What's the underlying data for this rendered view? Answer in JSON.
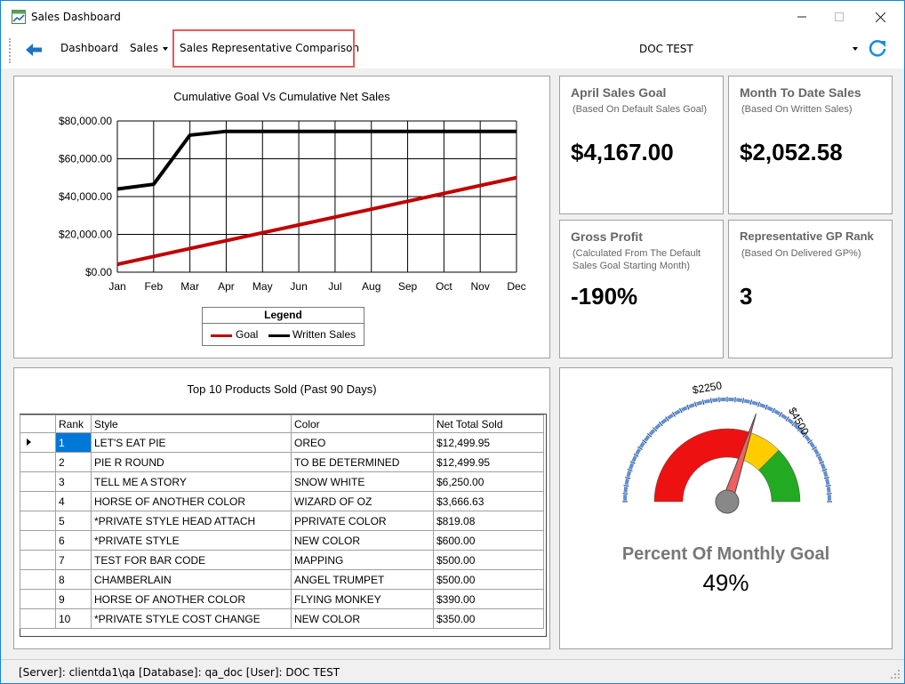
{
  "window": {
    "title": "Sales Dashboard",
    "minimize_icon": "minimize-icon",
    "maximize_icon": "maximize-icon",
    "close_icon": "close-icon"
  },
  "toolbar": {
    "back_icon": "back-arrow-icon",
    "dashboard_label": "Dashboard",
    "sales_label": "Sales",
    "comparison_label": "Sales Representative Comparison",
    "combo_value": "DOC TEST",
    "refresh_icon": "refresh-icon"
  },
  "colors": {
    "accent": "#1883d7",
    "goal_line": "#c00000",
    "written_line": "#000000",
    "highlight_box": "#e85a5a",
    "selection": "#0078d7"
  },
  "chart": {
    "title": "Cumulative Goal Vs Cumulative Net Sales",
    "legend_title": "Legend",
    "legend_goal": "Goal",
    "legend_written": "Written Sales"
  },
  "chart_data": {
    "type": "line",
    "title": "Cumulative Goal Vs Cumulative Net Sales",
    "categories": [
      "Jan",
      "Feb",
      "Mar",
      "Apr",
      "May",
      "Jun",
      "Jul",
      "Aug",
      "Sep",
      "Oct",
      "Nov",
      "Dec"
    ],
    "y_ticks": [
      "$80,000.00",
      "$60,000.00",
      "$40,000.00",
      "$20,000.00",
      "$0.00"
    ],
    "ylim": [
      0,
      80000
    ],
    "grid": true,
    "legend_position": "bottom",
    "series": [
      {
        "name": "Goal",
        "color": "#c00000",
        "values": [
          4167,
          8333,
          12500,
          16667,
          20833,
          25000,
          29167,
          33333,
          37500,
          41667,
          45833,
          50000
        ]
      },
      {
        "name": "Written Sales",
        "color": "#000000",
        "values": [
          44000,
          46500,
          72500,
          74500,
          74500,
          74500,
          74500,
          74500,
          74500,
          74500,
          74500,
          74500
        ]
      }
    ]
  },
  "kpis": {
    "april_goal": {
      "title": "April Sales Goal",
      "sub": "(Based On Default Sales Goal)",
      "value": "$4,167.00"
    },
    "mtd_sales": {
      "title": "Month To Date Sales",
      "sub": "(Based On Written Sales)",
      "value": "$2,052.58"
    },
    "gross_profit": {
      "title": "Gross Profit",
      "sub": "(Calculated From The Default Sales Goal Starting Month)",
      "value": "-190%"
    },
    "gp_rank": {
      "title": "Representative GP Rank",
      "sub": "(Based On Delivered GP%)",
      "value": "3"
    }
  },
  "products": {
    "title": "Top 10 Products Sold (Past 90 Days)",
    "columns": [
      "Rank",
      "Style",
      "Color",
      "Net Total Sold"
    ],
    "rows": [
      {
        "rank": "1",
        "style": "LET'S EAT PIE",
        "color": "OREO",
        "total": "$12,499.95"
      },
      {
        "rank": "2",
        "style": "PIE R ROUND",
        "color": "TO BE DETERMINED",
        "total": "$12,499.95"
      },
      {
        "rank": "3",
        "style": "TELL ME A STORY",
        "color": "SNOW WHITE",
        "total": "$6,250.00"
      },
      {
        "rank": "4",
        "style": "HORSE OF ANOTHER COLOR",
        "color": "WIZARD OF OZ",
        "total": "$3,666.63"
      },
      {
        "rank": "5",
        "style": "*PRIVATE STYLE  HEAD ATTACH",
        "color": "PPRIVATE COLOR",
        "total": "$819.08"
      },
      {
        "rank": "6",
        "style": "*PRIVATE STYLE",
        "color": "NEW COLOR",
        "total": "$600.00"
      },
      {
        "rank": "7",
        "style": "TEST FOR BAR CODE",
        "color": "MAPPING",
        "total": "$500.00"
      },
      {
        "rank": "8",
        "style": "CHAMBERLAIN",
        "color": "ANGEL TRUMPET",
        "total": "$500.00"
      },
      {
        "rank": "9",
        "style": "HORSE OF ANOTHER COLOR",
        "color": "FLYING MONKEY",
        "total": "$390.00"
      },
      {
        "rank": "10",
        "style": "*PRIVATE STYLE COST CHANGE",
        "color": "NEW COLOR",
        "total": "$350.00"
      }
    ]
  },
  "gauge": {
    "label": "Percent Of Monthly Goal",
    "value": "49%",
    "percent": 49,
    "tick_label_1": "$2250",
    "tick_label_2": "$4500",
    "zones": [
      "#ee1111",
      "#ee1111",
      "#ffcc00",
      "#22aa22"
    ]
  },
  "status": {
    "text": "[Server]: clientda1\\qa  [Database]: qa_doc  [User]: DOC TEST"
  }
}
